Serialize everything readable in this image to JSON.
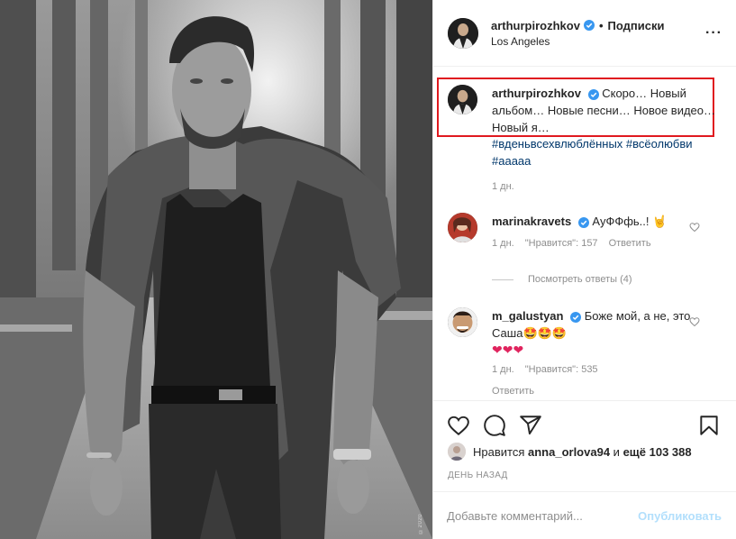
{
  "header": {
    "username": "arthurpirozhkov",
    "separator": "•",
    "follow_label": "Подписки",
    "location": "Los Angeles"
  },
  "caption": {
    "username": "arthurpirozhkov",
    "text": "Скоро… Новый альбом… Новые песни… Новое видео… Новый я…",
    "hashtags": "#вденьвсехвлюблённых #всёолюбви #ааааа",
    "time": "1 дн."
  },
  "comments": [
    {
      "username": "marinakravets",
      "text": "АуФФфь..!",
      "time": "1 дн.",
      "likes": "\"Нравится\": 157",
      "reply_label": "Ответить"
    },
    {
      "username": "m_galustyan",
      "text": "Боже мой, а не, это Саша",
      "time": "1 дн.",
      "likes": "\"Нравится\": 535",
      "reply_label": "Ответить"
    }
  ],
  "view_replies_label": "Посмотреть ответы (4)",
  "likes": {
    "prefix": "Нравится",
    "user": "anna_orlova94",
    "middle": "и",
    "rest": "ещё 103 388"
  },
  "post_date": "ДЕНЬ НАЗАД",
  "add_comment": {
    "placeholder": "Добавьте комментарий...",
    "publish_label": "Опубликовать"
  },
  "photo_credit": "©2020",
  "colors": {
    "verified": "#3897f0",
    "link": "#00376b",
    "highlight_border": "#e0191f",
    "publish_disabled": "#b2dffc",
    "muted": "#8e8e8e"
  },
  "icons": [
    "verified-badge-icon",
    "more-options-icon",
    "heart-icon",
    "comment-icon",
    "share-icon",
    "bookmark-icon"
  ]
}
